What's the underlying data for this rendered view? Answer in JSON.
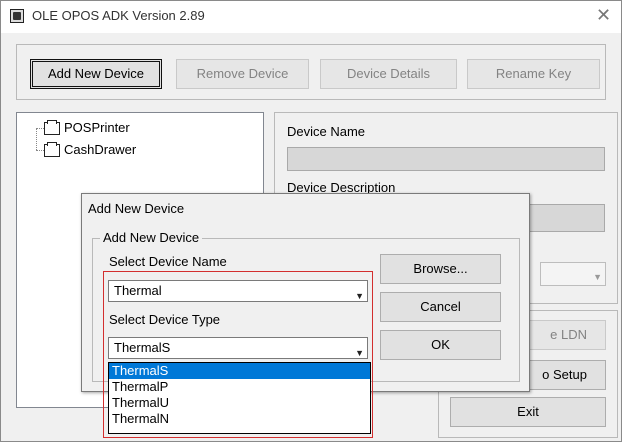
{
  "window": {
    "title": "OLE OPOS ADK Version 2.89"
  },
  "toolbar": {
    "add_device": "Add New Device",
    "remove_device": "Remove Device",
    "device_details": "Device Details",
    "rename_key": "Rename Key"
  },
  "tree": {
    "items": [
      "POSPrinter",
      "CashDrawer"
    ]
  },
  "right_panel": {
    "device_name_label": "Device Name",
    "device_description_label": "Device Description"
  },
  "bottom_buttons": {
    "ldn_partial": "e LDN",
    "setup_partial": "o Setup",
    "exit": "Exit"
  },
  "dialog": {
    "title": "Add New Device",
    "group_label": "Add New Device",
    "select_name_label": "Select Device Name",
    "device_name_value": "Thermal",
    "select_type_label": "Select Device Type",
    "device_type_value": "ThermalS",
    "browse": "Browse...",
    "cancel": "Cancel",
    "ok": "OK",
    "type_options": [
      "ThermalS",
      "ThermalP",
      "ThermalU",
      "ThermalN"
    ],
    "selected_option": "ThermalS"
  },
  "colors": {
    "selection": "#0078d7",
    "highlight_outline": "#d32f2f"
  }
}
